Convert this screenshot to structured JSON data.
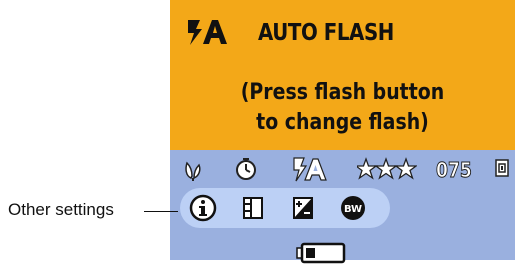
{
  "banner": {
    "icon": "auto-flash-icon",
    "title": "AUTO FLASH",
    "message_line1": "(Press flash button",
    "message_line2": "to change flash)",
    "background": "#f3a818"
  },
  "status_bar": {
    "background": "#9ab0df",
    "icons": [
      "macro-icon",
      "self-timer-icon",
      "auto-flash-icon",
      "quality-stars-icon",
      "memory-card-icon"
    ],
    "pictures_remaining": "075"
  },
  "settings_strip": {
    "background": "#bcd0f5",
    "icons": [
      "info-icon",
      "exposure-metering-icon",
      "exposure-compensation-icon",
      "black-white-color-mode-icon"
    ]
  },
  "battery": {
    "icon": "battery-low-icon"
  },
  "callout": {
    "label": "Other settings"
  }
}
